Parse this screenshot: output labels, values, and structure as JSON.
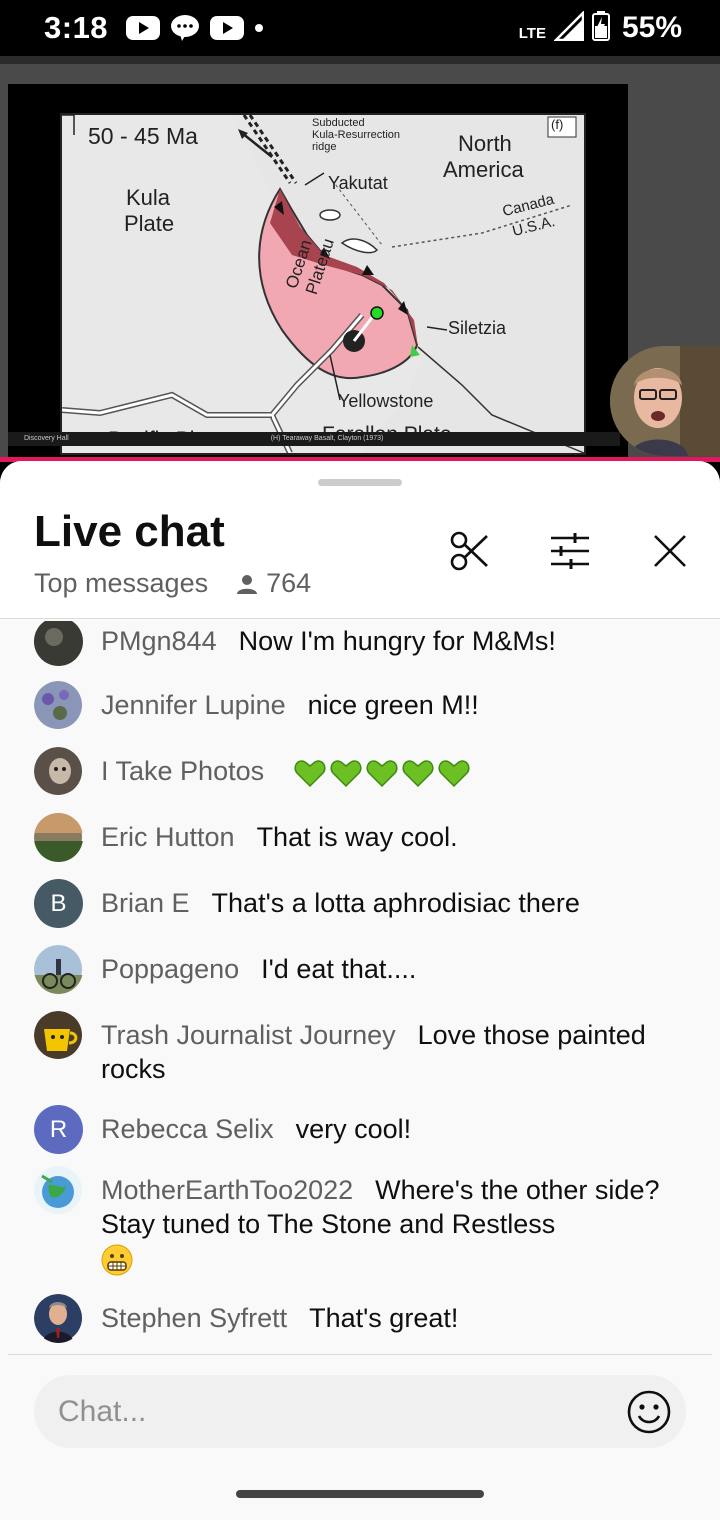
{
  "status_bar": {
    "time": "3:18",
    "network": "LTE",
    "battery": "55%",
    "notification_icons": [
      "youtube-icon",
      "chat-bubble-icon",
      "youtube-icon",
      "dot-icon"
    ]
  },
  "video": {
    "slide": {
      "period": "50 - 45 Ma",
      "panel_letter": "(f)",
      "kula_plate": "Kula Plate",
      "kula_line1": "Kula",
      "kula_line2": "Plate",
      "subducted_line1": "Subducted",
      "subducted_line2": "Kula-Resurrection",
      "subducted_line3": "ridge",
      "yakutat": "Yakutat",
      "north_america_line1": "North",
      "north_america_line2": "America",
      "canada": "Canada",
      "usa": "U.S.A.",
      "ocean_plateau_line1": "Ocean",
      "ocean_plateau_line2": "Plateau",
      "siletzia": "Siletzia",
      "yellowstone": "Yellowstone",
      "pacific_plate": "Pacific Plate",
      "farallon_plate": "Farallon Plate",
      "footer_left": "Discovery Hall",
      "footer_center": "(H) Tearaway Basalt, Clayton (1973)"
    },
    "progress_color": "#e0195c"
  },
  "chat": {
    "title": "Live chat",
    "filter": "Top messages",
    "viewers": "764",
    "messages": [
      {
        "author": "PMgn844",
        "text": "Now I'm hungry for M&Ms!",
        "avatar_letter": "",
        "avatar_color": "#3a3a34"
      },
      {
        "author": "Jennifer Lupine",
        "text": "nice green M!!",
        "avatar_letter": "",
        "avatar_color": "#6a6f9a"
      },
      {
        "author": "I Take Photos",
        "text": "",
        "avatar_letter": "",
        "avatar_color": "#5a5048"
      },
      {
        "author": "Eric Hutton",
        "text": "That is way cool.",
        "avatar_letter": "",
        "avatar_color": "#55604a"
      },
      {
        "author": "Brian E",
        "text": "That's a lotta aphrodisiac there",
        "avatar_letter": "B",
        "avatar_color": "#455a64"
      },
      {
        "author": "Poppageno",
        "text": "I'd eat that....",
        "avatar_letter": "",
        "avatar_color": "#7a8a6a"
      },
      {
        "author": "Trash Journalist Journey",
        "text": "Love those painted rocks",
        "avatar_letter": "",
        "avatar_color": "#c9a400"
      },
      {
        "author": "Rebecca Selix",
        "text": "very cool!",
        "avatar_letter": "R",
        "avatar_color": "#5c6bc0"
      },
      {
        "author": "MotherEarthToo2022",
        "text": "Where's the other side? Stay tuned to The Stone and Restless",
        "avatar_letter": "",
        "avatar_color": "#5aa0c8"
      },
      {
        "author": "Stephen Syfrett",
        "text": "That's great!",
        "avatar_letter": "",
        "avatar_color": "#2c3e63"
      }
    ],
    "input_placeholder": "Chat..."
  }
}
